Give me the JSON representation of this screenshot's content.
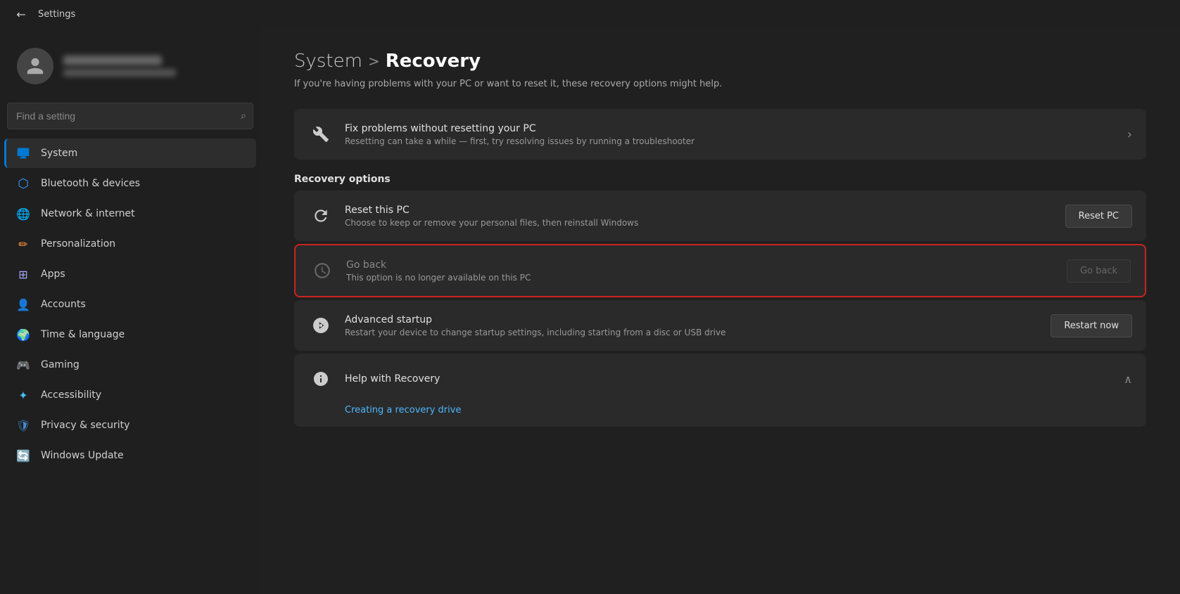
{
  "titleBar": {
    "backLabel": "←",
    "appName": "Settings"
  },
  "sidebar": {
    "searchPlaceholder": "Find a setting",
    "searchIcon": "🔍",
    "navItems": [
      {
        "id": "system",
        "label": "System",
        "icon": "💻",
        "active": true,
        "color": "#0078d4"
      },
      {
        "id": "bluetooth",
        "label": "Bluetooth & devices",
        "icon": "🔷",
        "active": false
      },
      {
        "id": "network",
        "label": "Network & internet",
        "icon": "🌐",
        "active": false
      },
      {
        "id": "personalization",
        "label": "Personalization",
        "icon": "✏️",
        "active": false
      },
      {
        "id": "apps",
        "label": "Apps",
        "icon": "🗂️",
        "active": false
      },
      {
        "id": "accounts",
        "label": "Accounts",
        "icon": "👤",
        "active": false
      },
      {
        "id": "time",
        "label": "Time & language",
        "icon": "🌍",
        "active": false
      },
      {
        "id": "gaming",
        "label": "Gaming",
        "icon": "🎮",
        "active": false
      },
      {
        "id": "accessibility",
        "label": "Accessibility",
        "icon": "♿",
        "active": false
      },
      {
        "id": "privacy",
        "label": "Privacy & security",
        "icon": "🛡️",
        "active": false
      },
      {
        "id": "windowsupdate",
        "label": "Windows Update",
        "icon": "🔄",
        "active": false
      }
    ]
  },
  "content": {
    "breadcrumb": {
      "system": "System",
      "separator": ">",
      "page": "Recovery"
    },
    "description": "If you're having problems with your PC or want to reset it, these recovery options might help.",
    "fixProblemsCard": {
      "title": "Fix problems without resetting your PC",
      "subtitle": "Resetting can take a while — first, try resolving issues by running a troubleshooter"
    },
    "sectionTitle": "Recovery options",
    "resetCard": {
      "title": "Reset this PC",
      "subtitle": "Choose to keep or remove your personal files, then reinstall Windows",
      "buttonLabel": "Reset PC"
    },
    "goBackCard": {
      "title": "Go back",
      "subtitle": "This option is no longer available on this PC",
      "buttonLabel": "Go back"
    },
    "advancedStartupCard": {
      "title": "Advanced startup",
      "subtitle": "Restart your device to change startup settings, including starting from a disc or USB drive",
      "buttonLabel": "Restart now"
    },
    "helpCard": {
      "title": "Help with Recovery",
      "link": "Creating a recovery drive"
    }
  }
}
